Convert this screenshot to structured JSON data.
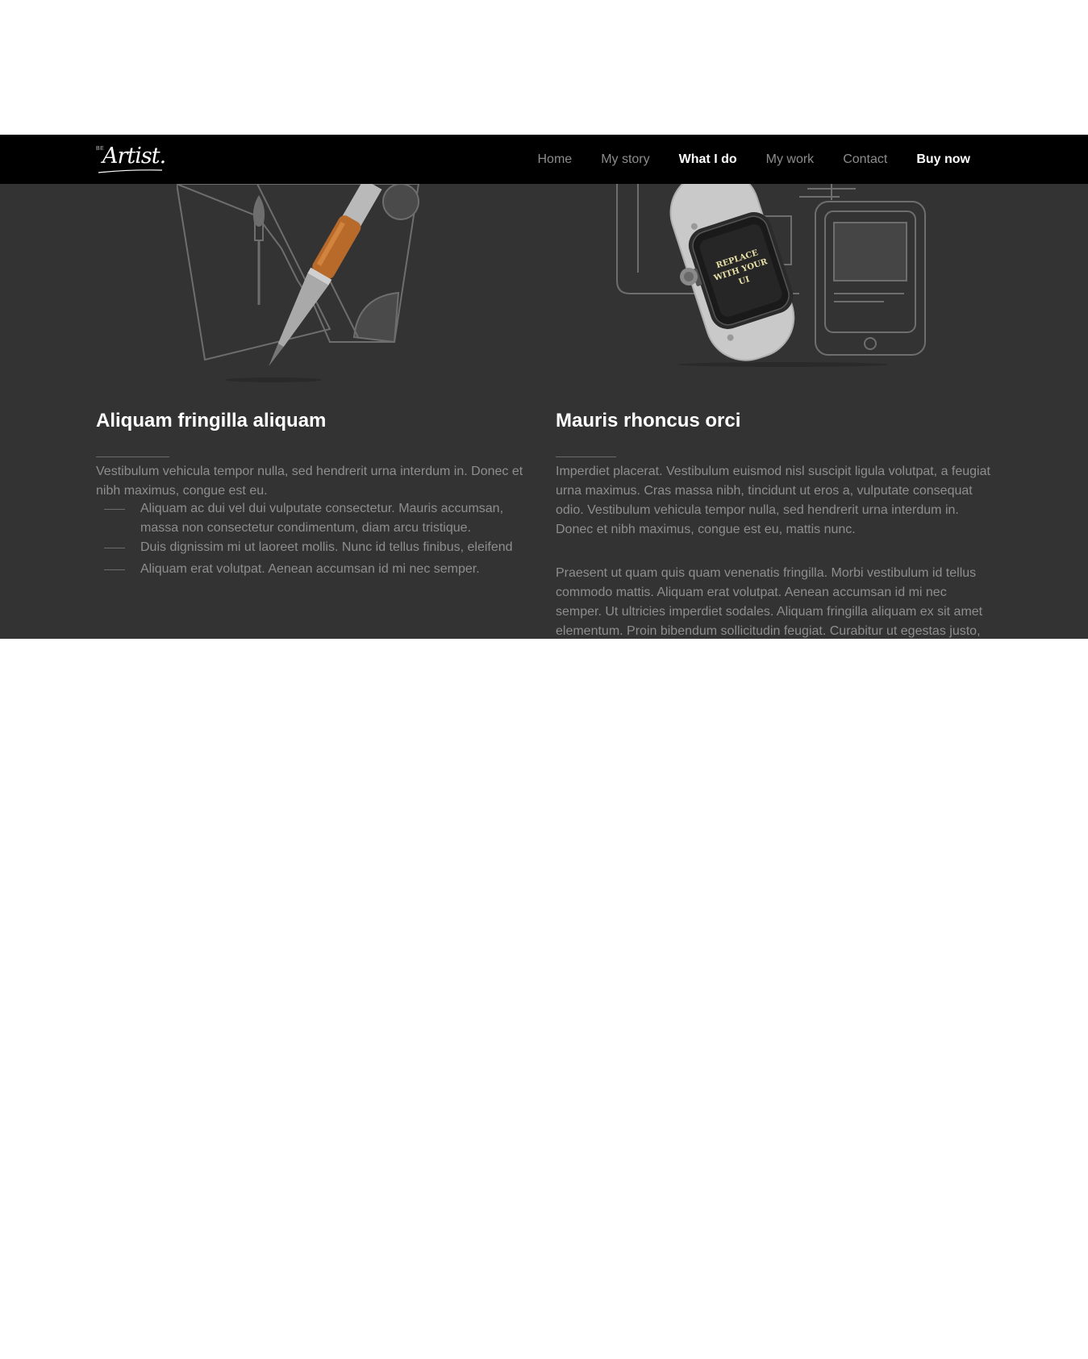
{
  "nav": {
    "logo": {
      "small": "BE",
      "text": "Artist."
    },
    "links": [
      {
        "label": "Home"
      },
      {
        "label": "My story"
      },
      {
        "label": "What I do"
      },
      {
        "label": "My work"
      },
      {
        "label": "Contact"
      },
      {
        "label": "Buy now"
      }
    ]
  },
  "left": {
    "heading": "Aliquam fringilla aliquam",
    "intro": "Vestibulum vehicula tempor nulla, sed hendrerit urna interdum in. Donec et nibh maximus, congue est eu.",
    "bullets": [
      "Aliquam ac dui vel dui vulputate consectetur. Mauris accumsan, massa non consectetur condimentum, diam arcu tristique.",
      "Duis dignissim mi ut laoreet mollis. Nunc id tellus finibus, eleifend",
      "Aliquam erat volutpat. Aenean accumsan id mi nec semper."
    ]
  },
  "right": {
    "heading": "Mauris rhoncus orci",
    "watch_screen_text": "REPLACE WITH YOUR UI",
    "paragraphs": [
      "Imperdiet placerat. Vestibulum euismod nisl suscipit ligula volutpat, a feugiat urna maximus. Cras massa nibh, tincidunt ut eros a, vulputate consequat odio. Vestibulum vehicula tempor nulla, sed hendrerit urna interdum in. Donec et nibh maximus, congue est eu, mattis nunc.",
      "Praesent ut quam quis quam venenatis fringilla. Morbi vestibulum id tellus commodo mattis. Aliquam erat volutpat. Aenean accumsan id mi nec semper. Ut ultricies imperdiet sodales. Aliquam fringilla aliquam ex sit amet elementum. Proin bibendum sollicitudin feugiat. Curabitur ut egestas justo,"
    ]
  },
  "colors": {
    "navbar_bg": "#000000",
    "section_bg": "#333333",
    "text_muted": "#8e8e8e",
    "heading": "#ffffff"
  }
}
